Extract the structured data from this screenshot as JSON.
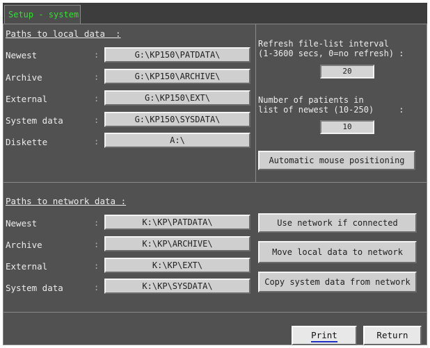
{
  "window": {
    "tab_title": "Setup - system"
  },
  "local": {
    "header": "Paths to local data  :",
    "rows": [
      {
        "label": "Newest",
        "value": "G:\\KP150\\PATDATA\\"
      },
      {
        "label": "Archive",
        "value": "G:\\KP150\\ARCHIVE\\"
      },
      {
        "label": "External",
        "value": "G:\\KP150\\EXT\\"
      },
      {
        "label": "System data",
        "value": "G:\\KP150\\SYSDATA\\"
      },
      {
        "label": "Diskette",
        "value": "A:\\"
      }
    ]
  },
  "refresh": {
    "label_line1": "Refresh file-list interval",
    "label_line2": "(1-3600 secs, 0=no refresh) :",
    "value": "20"
  },
  "patients": {
    "label_line1": "Number of patients in",
    "label_line2": "list of newest (10-250)     :",
    "value": "10"
  },
  "auto_mouse_label": "Automatic mouse positioning",
  "network": {
    "header": "Paths to network data :",
    "rows": [
      {
        "label": "Newest",
        "value": "K:\\KP\\PATDATA\\"
      },
      {
        "label": "Archive",
        "value": "K:\\KP\\ARCHIVE\\"
      },
      {
        "label": "External",
        "value": "K:\\KP\\EXT\\"
      },
      {
        "label": "System data",
        "value": "K:\\KP\\SYSDATA\\"
      }
    ]
  },
  "network_actions": {
    "use_network": "Use network if connected",
    "move_local": "Move local data to network",
    "copy_system": "Copy system data from network"
  },
  "footer": {
    "print_label": "Print",
    "return_label": "Return"
  },
  "colors": {
    "background": "#515151",
    "title_text": "#32e032",
    "button_face": "#cfcfcf",
    "print_underline": "#2030c0"
  }
}
